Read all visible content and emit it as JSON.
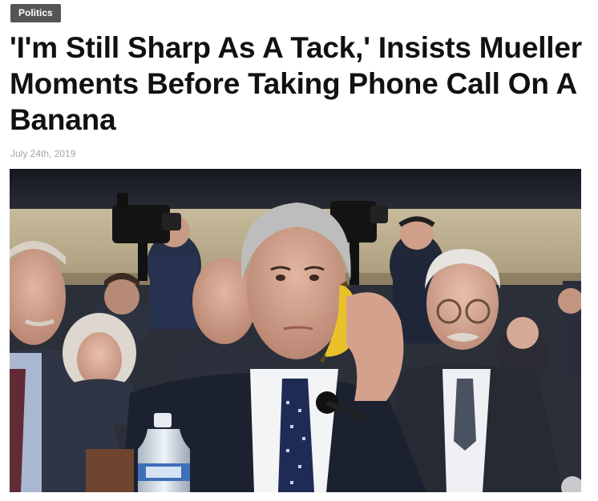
{
  "article": {
    "category": "Politics",
    "headline": "'I'm Still Sharp As A Tack,' Insists Mueller Moments Before Taking Phone Call On A Banana",
    "date": "July 24th, 2019"
  },
  "photo": {
    "subject": "photo-of-hearing-room",
    "accent_colors": {
      "banana": "#e9c22a",
      "wall": "#b9ab8b",
      "suit": "#1c2130"
    }
  }
}
